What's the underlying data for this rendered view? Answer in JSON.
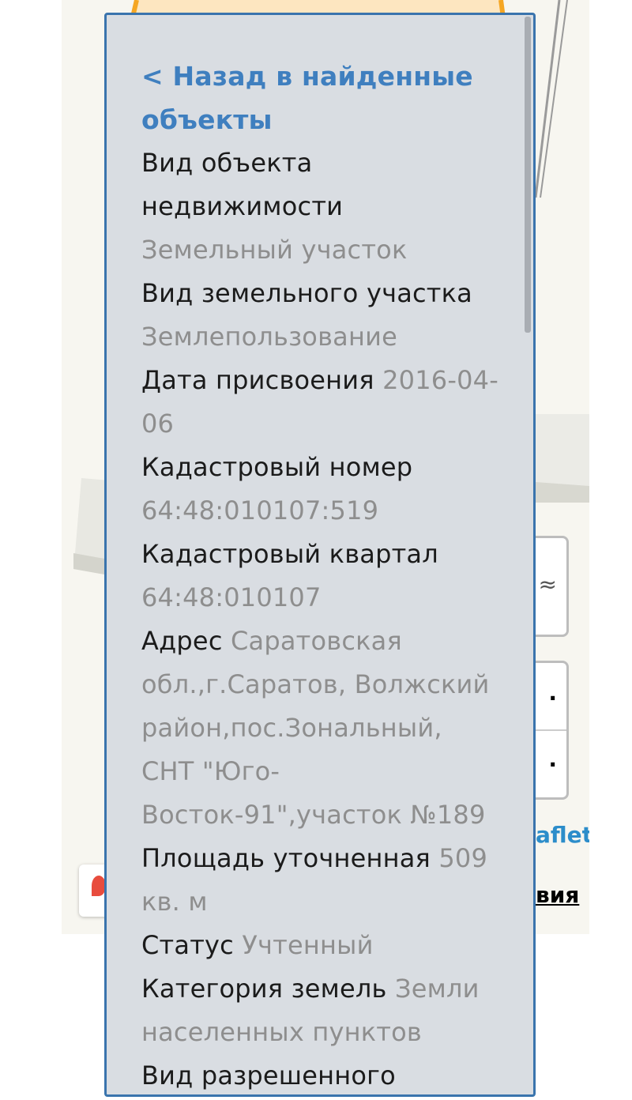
{
  "panel": {
    "back_link": "< Назад в найденные объекты",
    "rows": [
      {
        "label": "Вид объекта недвижимости",
        "value": "Земельный участок",
        "break": true
      },
      {
        "label": "Вид земельного участка",
        "value": "Землепользование",
        "break": true
      },
      {
        "label": "Дата присвоения",
        "value": "2016-04-06",
        "break": false
      },
      {
        "label": "Кадастровый номер",
        "value": "64:48:010107:519",
        "break": true
      },
      {
        "label": "Кадастровый квартал",
        "value": "64:48:010107",
        "break": true
      },
      {
        "label": "Адрес",
        "value": "Саратовская обл.,г.Саратов, Волжский район,пос.Зональный, СНТ \"Юго-Восток-91\",участок №189",
        "break": false
      },
      {
        "label": "Площадь уточненная",
        "value": "509 кв. м",
        "break": false
      },
      {
        "label": "Статус",
        "value": "Учтенный",
        "break": false
      },
      {
        "label": "Категория земель",
        "value": "Земли населенных пунктов",
        "break": false
      },
      {
        "label": "Вид разрешенного",
        "value": "",
        "break": false
      }
    ]
  },
  "map": {
    "attribution_partial": "aflet",
    "link_partial": "вия"
  },
  "colors": {
    "panel_bg": "#d9dde2",
    "panel_border": "#3a74ad",
    "link": "#3f7fbf",
    "value": "#8e8e8e",
    "parcel_outline": "#f5a623"
  }
}
